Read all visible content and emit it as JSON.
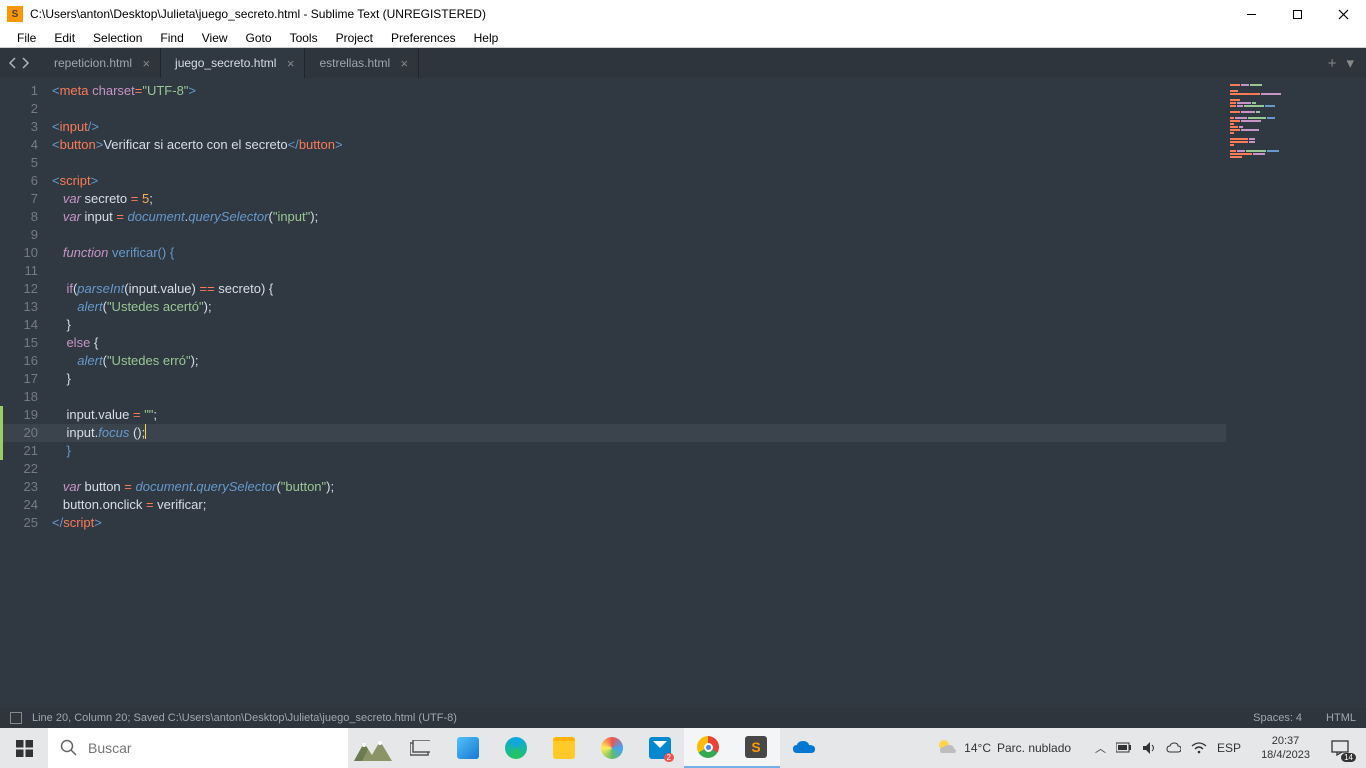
{
  "title": "C:\\Users\\anton\\Desktop\\Julieta\\juego_secreto.html - Sublime Text (UNREGISTERED)",
  "menu": [
    "File",
    "Edit",
    "Selection",
    "Find",
    "View",
    "Goto",
    "Tools",
    "Project",
    "Preferences",
    "Help"
  ],
  "tabs": [
    {
      "label": "repeticion.html",
      "active": false
    },
    {
      "label": "juego_secreto.html",
      "active": true
    },
    {
      "label": "estrellas.html",
      "active": false
    }
  ],
  "status": {
    "left": "Line 20, Column 20; Saved C:\\Users\\anton\\Desktop\\Julieta\\juego_secreto.html (UTF-8)",
    "spaces": "Spaces: 4",
    "lang": "HTML"
  },
  "taskbar": {
    "search_placeholder": "Buscar",
    "weather_temp": "14°C",
    "weather_desc": "Parc. nublado",
    "lang": "ESP",
    "time": "20:37",
    "date": "18/4/2023",
    "notif_count": "14"
  },
  "lines": 25,
  "active_line": 20
}
